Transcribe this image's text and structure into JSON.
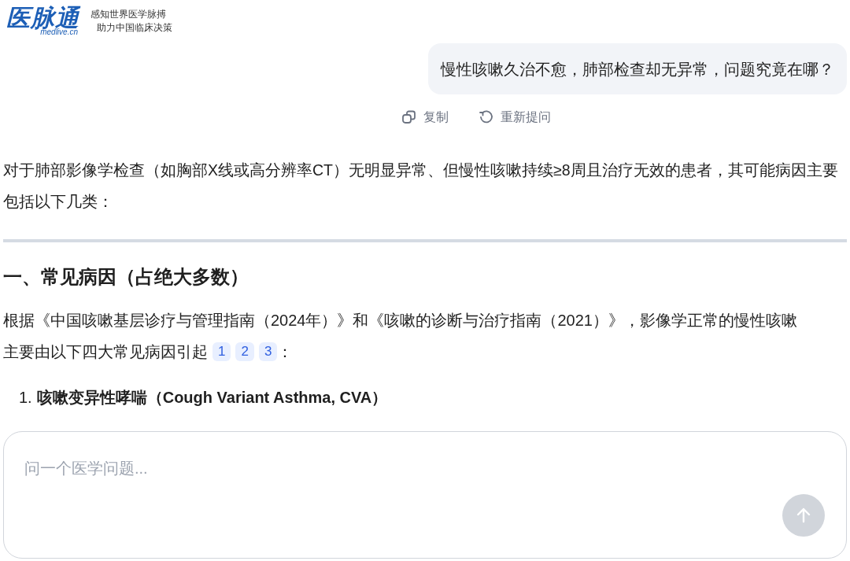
{
  "header": {
    "logo_text": "医脉通",
    "logo_domain": "medlive.cn",
    "slogan_lines": [
      "感知世界医学脉搏",
      "助力中国临床决策"
    ]
  },
  "user_message": {
    "text": "慢性咳嗽久治不愈，肺部检查却无异常，问题究竟在哪？",
    "actions": [
      {
        "kind": "copy",
        "label": "复制"
      },
      {
        "kind": "retry",
        "label": "重新提问"
      }
    ]
  },
  "answer": {
    "intro": "对于肺部影像学检查（如胸部X线或高分辨率CT）无明显异常、但慢性咳嗽持续≥8周且治疗无效的患者，其可能病因主要包括以下几类：",
    "heading": "一、常见病因（占绝大多数）",
    "paragraph_lines": [
      "根据《中国咳嗽基层诊疗与管理指南（2024年）》和《咳嗽的诊断与治疗指南（2021）》，影像学正常的慢性咳嗽",
      "主要由以下四大常见病因引起"
    ],
    "citations": [
      "1",
      "2",
      "3"
    ],
    "paragraph_end": "：",
    "list": [
      {
        "number": "1.",
        "text": "咳嗽变异性哮喘（Cough Variant Asthma, CVA）"
      }
    ]
  },
  "composer": {
    "placeholder": "问一个医学问题..."
  }
}
